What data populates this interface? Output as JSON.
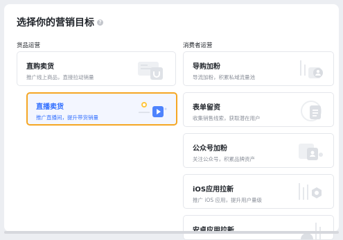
{
  "page": {
    "title": "选择你的营销目标"
  },
  "columns": {
    "left": {
      "label": "货品运营"
    },
    "right": {
      "label": "消费者运营"
    }
  },
  "left_cards": [
    {
      "title": "直购卖货",
      "desc": "推广线上商品，直接拉动销量",
      "selected": false
    },
    {
      "title": "直播卖货",
      "desc": "推广直播间，提升带货销量",
      "selected": true
    }
  ],
  "right_cards": [
    {
      "title": "导购加粉",
      "desc": "导流加粉，积累私域流量池"
    },
    {
      "title": "表单留资",
      "desc": "收集销售线索，获取潜在用户"
    },
    {
      "title": "公众号加粉",
      "desc": "关注公众号，积累品牌资产"
    },
    {
      "title": "iOS应用拉新",
      "desc": "推广 iOS 应用，提升用户量级"
    },
    {
      "title": "安卓应用拉新",
      "desc": ""
    }
  ],
  "colors": {
    "accent": "#3370ff",
    "selected_border": "#f5a623"
  }
}
